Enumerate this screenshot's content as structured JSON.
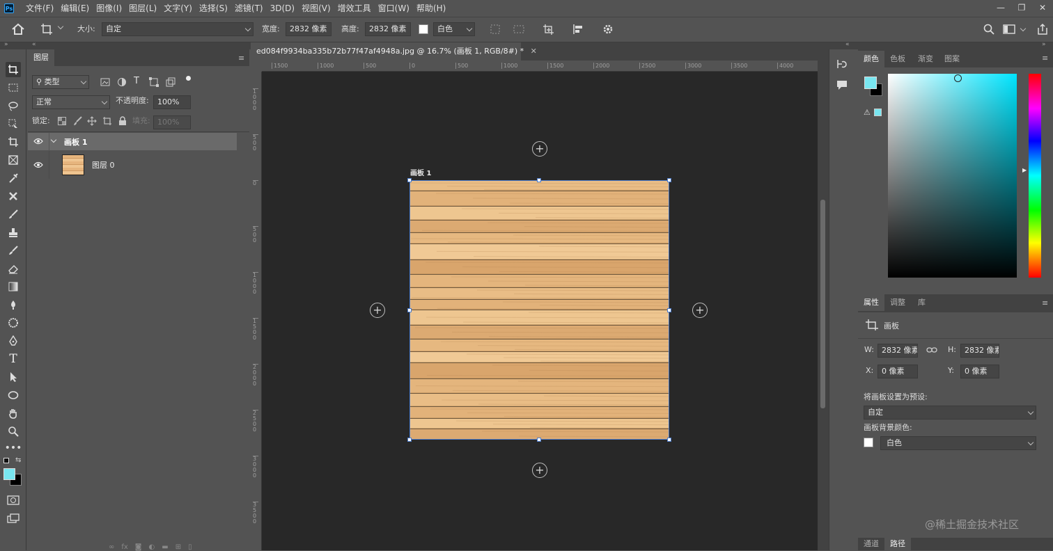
{
  "menu": {
    "items": [
      "文件(F)",
      "编辑(E)",
      "图像(I)",
      "图层(L)",
      "文字(Y)",
      "选择(S)",
      "滤镜(T)",
      "3D(D)",
      "视图(V)",
      "增效工具",
      "窗口(W)",
      "帮助(H)"
    ]
  },
  "options": {
    "size_label": "大小:",
    "size_value": "自定",
    "width_label": "宽度:",
    "width_value": "2832 像素",
    "height_label": "高度:",
    "height_value": "2832 像素",
    "bg_value": "白色"
  },
  "layers_panel": {
    "tab": "图层",
    "filter_kind": "类型",
    "blend_mode": "正常",
    "opacity_label": "不透明度:",
    "opacity_value": "100%",
    "lock_label": "锁定:",
    "fill_label": "填充:",
    "fill_value": "100%",
    "layers": [
      {
        "name": "画板 1",
        "type": "artboard"
      },
      {
        "name": "图层 0",
        "type": "layer"
      }
    ]
  },
  "document": {
    "tab_title": "ed084f9934ba335b72b77f47af4948a.jpg @ 16.7% (画板 1, RGB/8#) *",
    "artboard_label": "画板 1",
    "ruler_h": [
      "1500",
      "1000",
      "500",
      "0",
      "500",
      "1000",
      "1500",
      "2000",
      "2500",
      "3000",
      "3500",
      "4000"
    ],
    "ruler_v": [
      "1000",
      "500",
      "0",
      "500",
      "1000",
      "1500",
      "2000",
      "2500",
      "3000",
      "3500"
    ]
  },
  "color_panel": {
    "tabs": [
      "颜色",
      "色板",
      "渐变",
      "图案"
    ],
    "foreground": "#79e6f0",
    "background": "#000000",
    "hue": "#00e5ff"
  },
  "properties_panel": {
    "tabs": [
      "属性",
      "调整",
      "库"
    ],
    "kind": "画板",
    "w_label": "W:",
    "w_value": "2832 像素",
    "h_label": "H:",
    "h_value": "2832 像素",
    "x_label": "X:",
    "x_value": "0 像素",
    "y_label": "Y:",
    "y_value": "0 像素",
    "preset_label": "将画板设置为预设:",
    "preset_value": "自定",
    "bg_label": "画板背景颜色:",
    "bg_value": "白色"
  },
  "bottom_tabs": [
    "通道",
    "路径"
  ],
  "watermark": "@稀土掘金技术社区"
}
